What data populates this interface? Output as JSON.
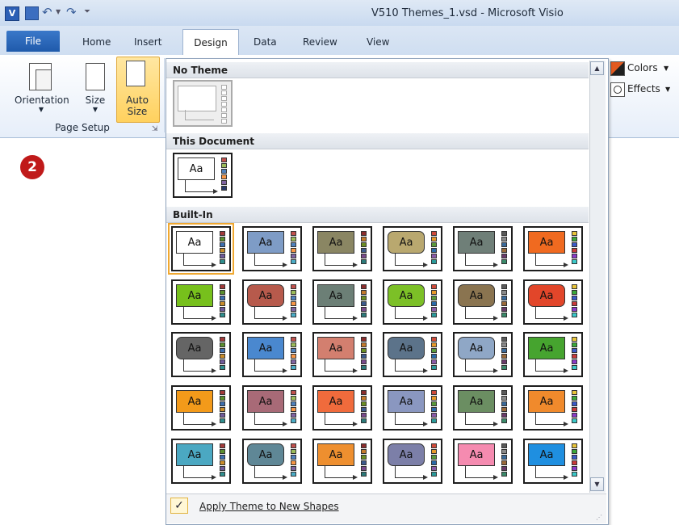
{
  "window": {
    "title": "V510 Themes_1.vsd  -  Microsoft Visio"
  },
  "tabs": [
    "File",
    "Home",
    "Insert",
    "Design",
    "Data",
    "Review",
    "View"
  ],
  "ribbon": {
    "orientation_label": "Orientation",
    "size_label": "Size",
    "autosize_label_1": "Auto",
    "autosize_label_2": "Size",
    "group_label": "Page Setup",
    "colors_label": "Colors",
    "effects_label": "Effects"
  },
  "gallery": {
    "sections": [
      "No Theme",
      "This Document",
      "Built-In"
    ],
    "thumb_text": "Aa",
    "builtin_fills": [
      "#ffffff",
      "#7e9cc6",
      "#8a8663",
      "#b9a86f",
      "#6f7f78",
      "#f06a20",
      "#77c01c",
      "#b75a4c",
      "#6c7f76",
      "#7cc027",
      "#8a7450",
      "#e2462a",
      "#656565",
      "#4a88cf",
      "#d37f6f",
      "#5c738a",
      "#8fa7c6",
      "#46a42f",
      "#f39a1a",
      "#a86a77",
      "#f06b3c",
      "#8a97c0",
      "#6b8e62",
      "#f08a2c",
      "#4ba8c2",
      "#5f8796",
      "#ee8f2f",
      "#7c7fa8",
      "#f58bb0",
      "#1f8fe0"
    ],
    "builtin_rounded": [
      false,
      false,
      false,
      true,
      false,
      false,
      false,
      true,
      false,
      true,
      true,
      true,
      true,
      false,
      false,
      true,
      true,
      false,
      false,
      false,
      false,
      false,
      false,
      false,
      false,
      true,
      false,
      true,
      false,
      false
    ],
    "swatch_sets": [
      [
        "#a23a3a",
        "#5a8e2e",
        "#3c6fb0",
        "#c98c2a",
        "#6f5a9a",
        "#2f8e8e"
      ],
      [
        "#c0504d",
        "#9bbb59",
        "#4f81bd",
        "#f79646",
        "#8064a2",
        "#4bacc6"
      ],
      [
        "#8c2d2d",
        "#c47a2c",
        "#6b8e23",
        "#3c5a8c",
        "#7a4a8c",
        "#2c7a7a"
      ],
      [
        "#d04a3a",
        "#e89a2a",
        "#5a9a3a",
        "#2a6aa8",
        "#8a5aa8",
        "#2a9a9a"
      ],
      [
        "#5a5a5a",
        "#8a8a8a",
        "#3a6a9a",
        "#9a6a3a",
        "#6a3a6a",
        "#3a8a6a"
      ],
      [
        "#e8c43a",
        "#3aa83a",
        "#3a5ac8",
        "#c83a3a",
        "#8a3ac8",
        "#3ac8c8"
      ]
    ]
  },
  "footer": {
    "check_glyph": "✓",
    "apply_label": "Apply Theme to New Shapes"
  },
  "badge": {
    "number": "2"
  }
}
